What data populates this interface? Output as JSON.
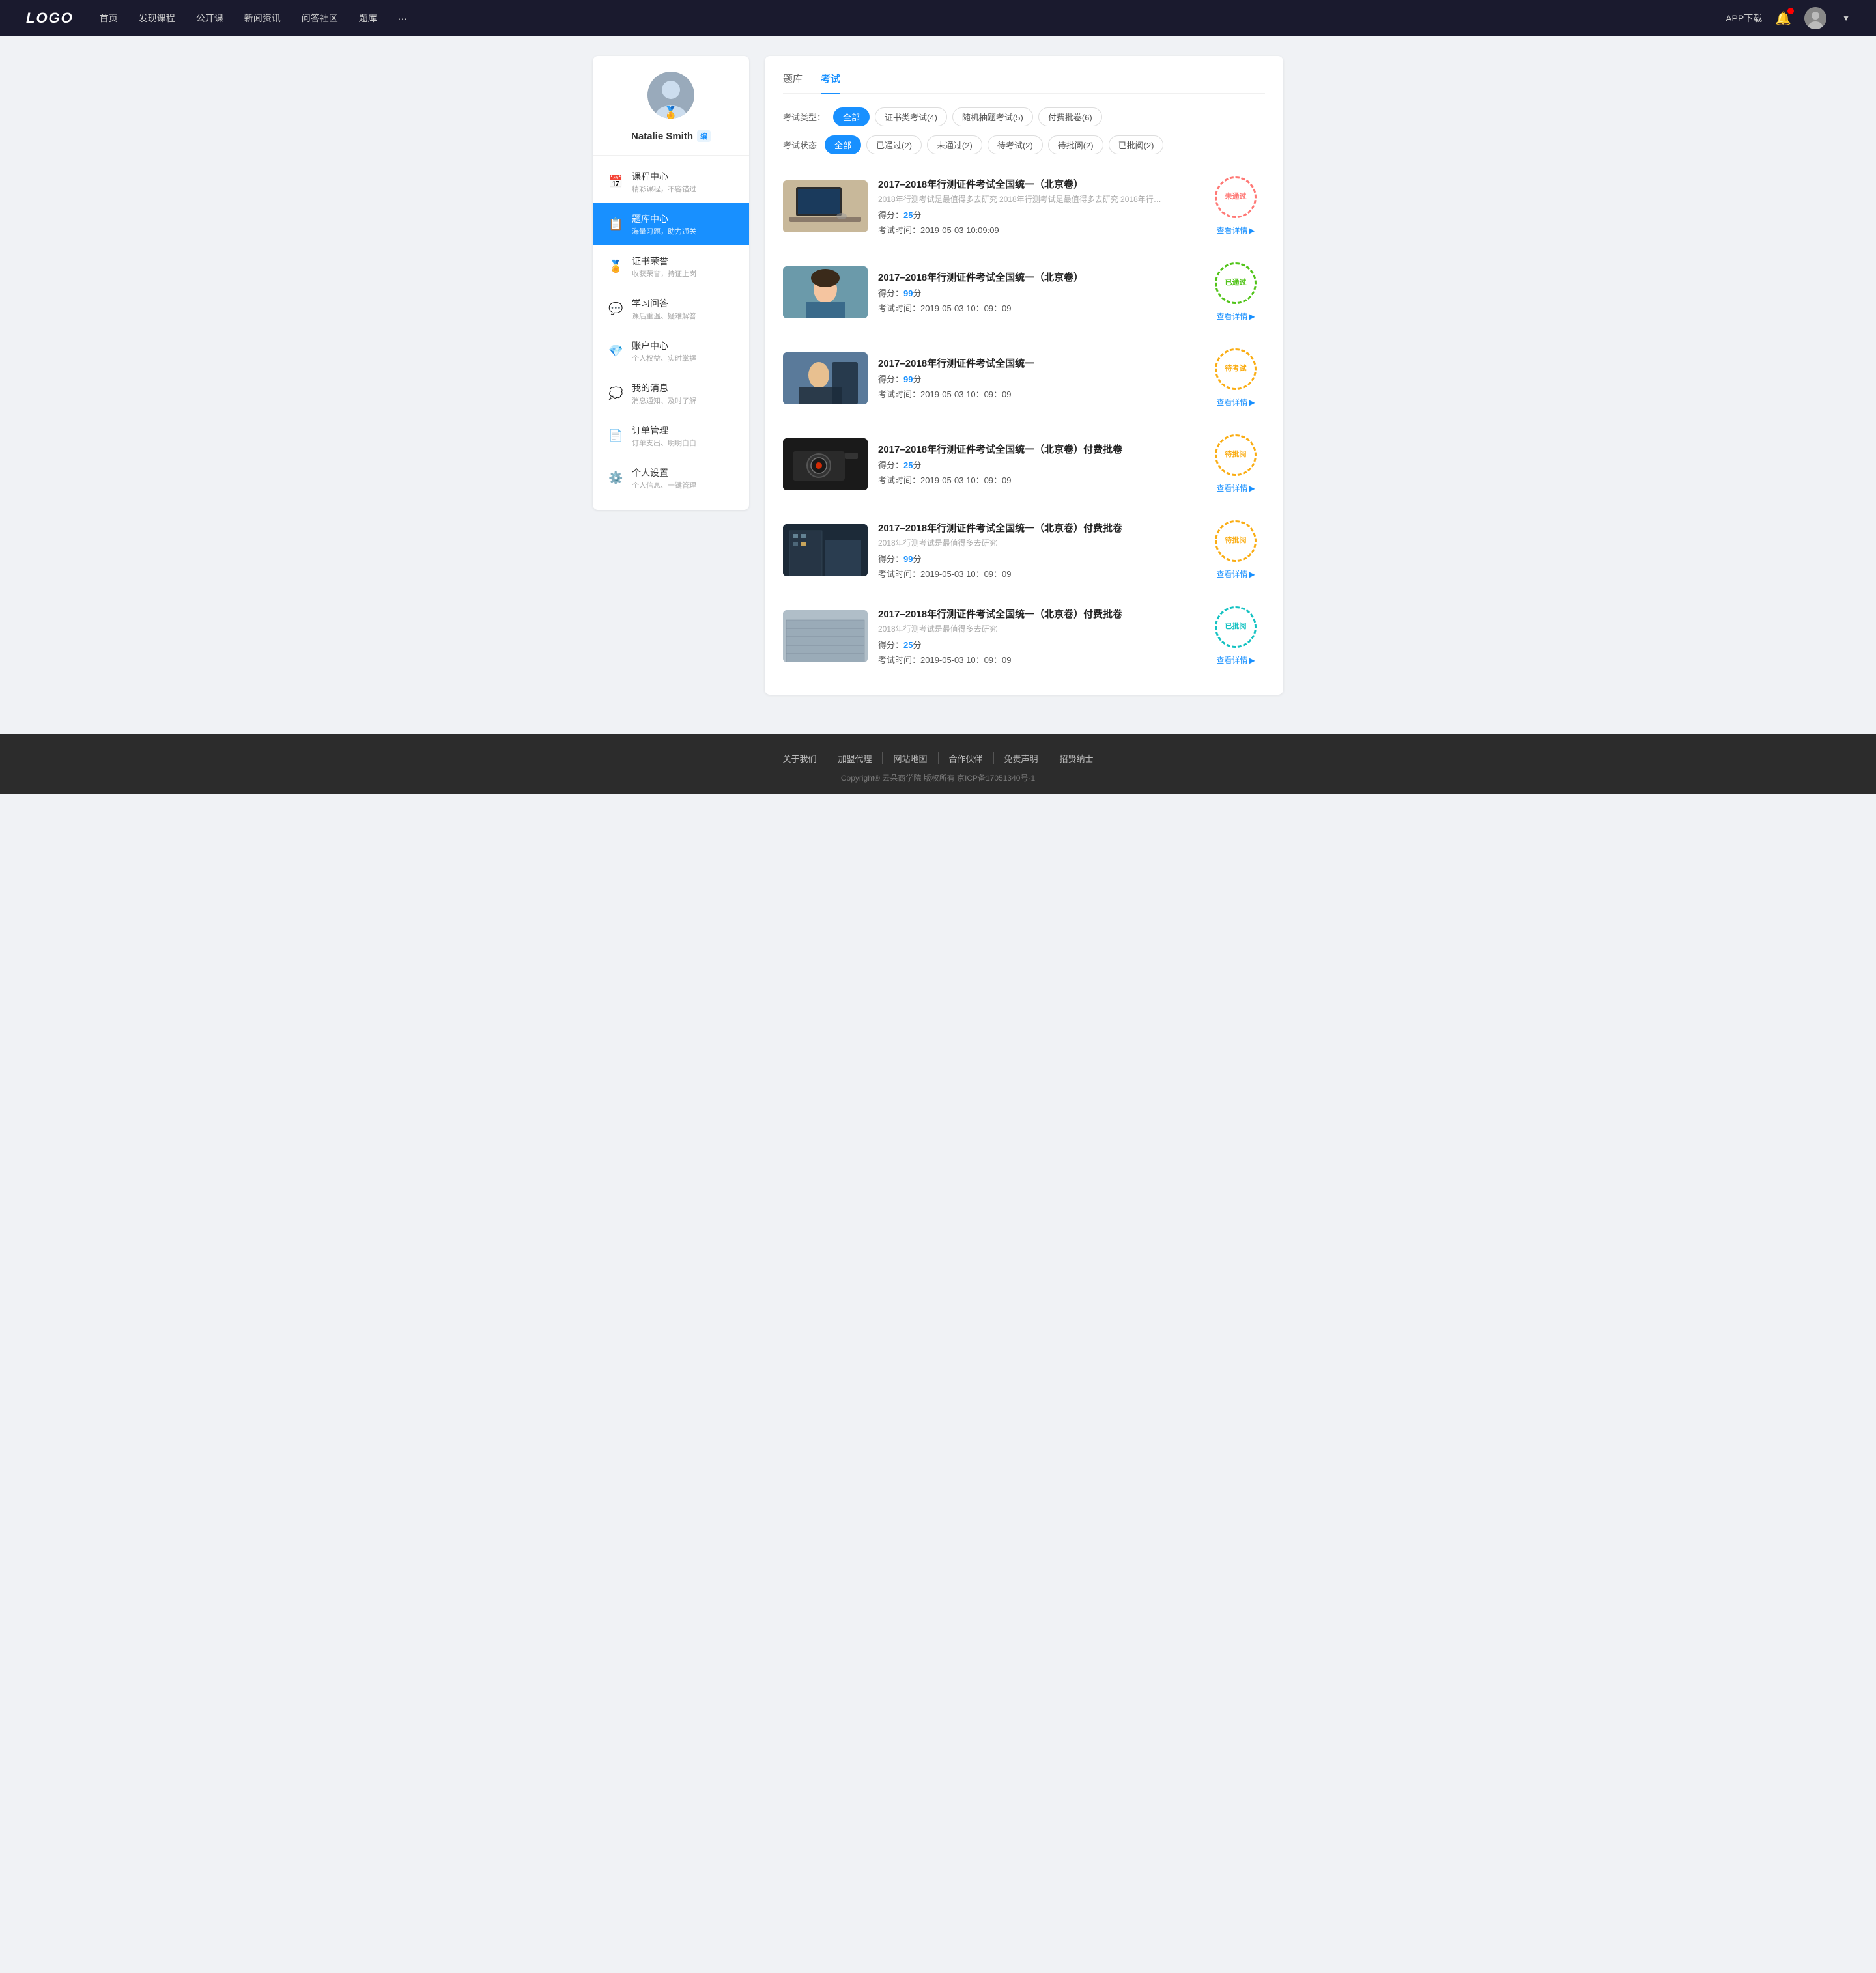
{
  "navbar": {
    "logo": "LOGO",
    "nav_items": [
      {
        "label": "首页",
        "href": "#"
      },
      {
        "label": "发现课程",
        "href": "#"
      },
      {
        "label": "公开课",
        "href": "#"
      },
      {
        "label": "新闻资讯",
        "href": "#"
      },
      {
        "label": "问答社区",
        "href": "#"
      },
      {
        "label": "题库",
        "href": "#"
      },
      {
        "label": "···",
        "href": "#"
      }
    ],
    "app_download": "APP下载",
    "username": "Natalie Smith"
  },
  "sidebar": {
    "username": "Natalie Smith",
    "badge": "编",
    "nav_items": [
      {
        "id": "course",
        "icon": "📅",
        "title": "课程中心",
        "subtitle": "精彩课程，不容错过"
      },
      {
        "id": "exam",
        "icon": "📋",
        "title": "题库中心",
        "subtitle": "海量习题，助力通关",
        "active": true
      },
      {
        "id": "cert",
        "icon": "🏅",
        "title": "证书荣誉",
        "subtitle": "收获荣誉，持证上岗"
      },
      {
        "id": "qa",
        "icon": "💬",
        "title": "学习问答",
        "subtitle": "课后重温、疑难解答"
      },
      {
        "id": "account",
        "icon": "💎",
        "title": "账户中心",
        "subtitle": "个人权益、实时掌握"
      },
      {
        "id": "msg",
        "icon": "💭",
        "title": "我的消息",
        "subtitle": "消息通知、及时了解"
      },
      {
        "id": "order",
        "icon": "📄",
        "title": "订单管理",
        "subtitle": "订单支出、明明白白"
      },
      {
        "id": "settings",
        "icon": "⚙️",
        "title": "个人设置",
        "subtitle": "个人信息、一键管理"
      }
    ]
  },
  "content": {
    "tabs": [
      {
        "label": "题库",
        "active": false
      },
      {
        "label": "考试",
        "active": true
      }
    ],
    "exam_type_label": "考试类型：",
    "exam_types": [
      {
        "label": "全部",
        "active": true
      },
      {
        "label": "证书类考试(4)",
        "active": false
      },
      {
        "label": "随机抽题考试(5)",
        "active": false
      },
      {
        "label": "付费批卷(6)",
        "active": false
      }
    ],
    "exam_status_label": "考试状态",
    "exam_statuses": [
      {
        "label": "全部",
        "active": true
      },
      {
        "label": "已通过(2)",
        "active": false
      },
      {
        "label": "未通过(2)",
        "active": false
      },
      {
        "label": "待考试(2)",
        "active": false
      },
      {
        "label": "待批阅(2)",
        "active": false
      },
      {
        "label": "已批阅(2)",
        "active": false
      }
    ],
    "exams": [
      {
        "id": 1,
        "title": "2017–2018年行测证件考试全国统一（北京卷）",
        "desc": "2018年行测考试是最值得多去研究 2018年行测考试是最值得多去研究 2018年行…",
        "score": "25",
        "score_unit": "分",
        "time": "2019-05-03  10:09:09",
        "status_text": "未通过",
        "status_type": "red",
        "thumb_class": "thumb-laptop",
        "detail_link": "查看详情"
      },
      {
        "id": 2,
        "title": "2017–2018年行测证件考试全国统一（北京卷）",
        "desc": "",
        "score": "99",
        "score_unit": "分",
        "time": "2019-05-03  10：09：09",
        "status_text": "已通过",
        "status_type": "green",
        "thumb_class": "thumb-woman",
        "detail_link": "查看详情"
      },
      {
        "id": 3,
        "title": "2017–2018年行测证件考试全国统一",
        "desc": "",
        "score": "99",
        "score_unit": "分",
        "time": "2019-05-03  10：09：09",
        "status_text": "待考试",
        "status_type": "orange",
        "thumb_class": "thumb-man",
        "detail_link": "查看详情"
      },
      {
        "id": 4,
        "title": "2017–2018年行测证件考试全国统一（北京卷）付费批卷",
        "desc": "",
        "score": "25",
        "score_unit": "分",
        "time": "2019-05-03  10：09：09",
        "status_text": "待批阅",
        "status_type": "orange",
        "thumb_class": "thumb-camera",
        "detail_link": "查看详情"
      },
      {
        "id": 5,
        "title": "2017–2018年行测证件考试全国统一（北京卷）付费批卷",
        "desc": "2018年行测考试是最值得多去研究",
        "score": "99",
        "score_unit": "分",
        "time": "2019-05-03  10：09：09",
        "status_text": "待批阅",
        "status_type": "orange",
        "thumb_class": "thumb-building1",
        "detail_link": "查看详情"
      },
      {
        "id": 6,
        "title": "2017–2018年行测证件考试全国统一（北京卷）付费批卷",
        "desc": "2018年行测考试是最值得多去研究",
        "score": "25",
        "score_unit": "分",
        "time": "2019-05-03  10：09：09",
        "status_text": "已批阅",
        "status_type": "teal",
        "thumb_class": "thumb-building2",
        "detail_link": "查看详情"
      }
    ]
  },
  "footer": {
    "links": [
      "关于我们",
      "加盟代理",
      "网站地图",
      "合作伙伴",
      "免责声明",
      "招贤纳士"
    ],
    "copyright": "Copyright® 云朵商学院  版权所有    京ICP备17051340号-1"
  }
}
